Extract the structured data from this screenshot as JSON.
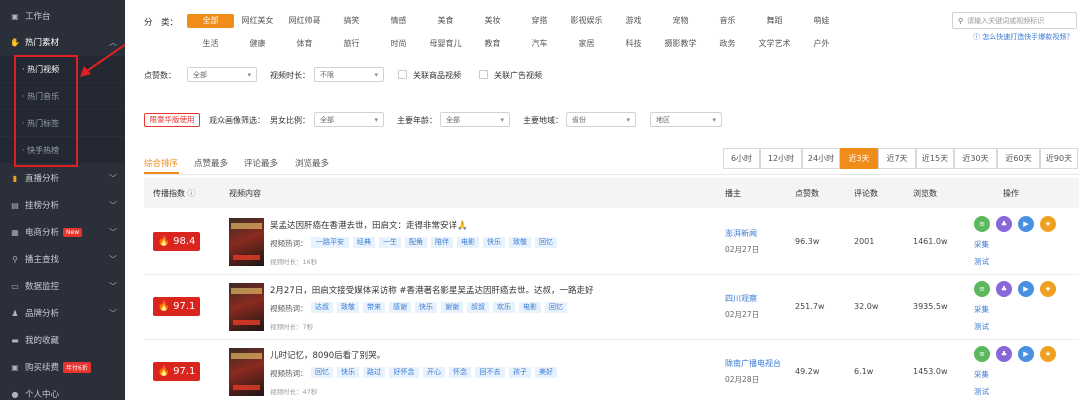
{
  "sidebar": {
    "top_item": "工作台",
    "section": "热门素材",
    "sub_items": [
      "热门视频",
      "热门音乐",
      "热门标签",
      "快手热榜"
    ],
    "items": [
      {
        "label": "直播分析"
      },
      {
        "label": "挂榜分析"
      },
      {
        "label": "电商分析",
        "badge": "New"
      },
      {
        "label": "播主查找"
      },
      {
        "label": "数据监控"
      },
      {
        "label": "品牌分析"
      },
      {
        "label": "我的收藏"
      },
      {
        "label": "购买续费",
        "badge": "年付6折"
      },
      {
        "label": "个人中心"
      }
    ]
  },
  "filters": {
    "category_label": "分　类：",
    "categories_row1": [
      "全部",
      "网红美女",
      "网红帅哥",
      "搞笑",
      "情感",
      "美食",
      "美妆",
      "穿搭",
      "影视娱乐",
      "游戏",
      "宠物",
      "音乐",
      "舞蹈",
      "萌娃"
    ],
    "categories_row2": [
      "生活",
      "健康",
      "体育",
      "旅行",
      "时尚",
      "母婴育儿",
      "教育",
      "汽车",
      "家居",
      "科技",
      "摄影教学",
      "政务",
      "文学艺术",
      "户外"
    ],
    "search_placeholder": "请输入关键词或视频标识",
    "help_link": "怎么快速打造快手爆款视频？",
    "likes_label": "点赞数：",
    "likes_value": "全部",
    "duration_label": "视频时长：",
    "duration_value": "不限",
    "related_product": "关联商品视频",
    "related_ad": "关联广告视频",
    "vip_tag": "限豪华版使用",
    "audience_label": "观众画像筛选：",
    "gender_label": "男女比例：",
    "gender_value": "全部",
    "age_label": "主要年龄：",
    "age_value": "全部",
    "region_label": "主要地域：",
    "province_value": "省份",
    "area_value": "地区"
  },
  "sort_tabs": [
    "综合排序",
    "点赞最多",
    "评论最多",
    "浏览最多"
  ],
  "time_tabs": [
    "6小时",
    "12小时",
    "24小时",
    "近3天",
    "近7天",
    "近15天",
    "近30天",
    "近60天",
    "近90天"
  ],
  "table": {
    "headers": [
      "传播指数",
      "视频内容",
      "播主",
      "点赞数",
      "评论数",
      "浏览数",
      "操作"
    ],
    "tags_label": "视频热词：",
    "op_labels": [
      "采集",
      "测试"
    ],
    "rows": [
      {
        "score": "98.4",
        "title": "吴孟达因肝癌在香港去世，田启文：走得非常安详🙏",
        "tags": [
          "一路平安",
          "经典",
          "一生",
          "配角",
          "陪伴",
          "电影",
          "快乐",
          "致敬",
          "回忆"
        ],
        "duration": "视频时长：16秒",
        "author": "澎湃新闻",
        "date": "02月27日",
        "likes": "96.3w",
        "comments": "2001",
        "views": "1461.0w"
      },
      {
        "score": "97.1",
        "title": "2月27日，田启文接受媒体采访称 #香港著名影星吴孟达因肝癌去世。达叔，一路走好",
        "tags": [
          "达叔",
          "致敬",
          "带来",
          "感谢",
          "快乐",
          "谢谢",
          "叔叔",
          "欢乐",
          "电影",
          "回忆"
        ],
        "duration": "视频时长：7秒",
        "author": "四川观察",
        "date": "02月27日",
        "likes": "251.7w",
        "comments": "32.0w",
        "views": "3935.5w"
      },
      {
        "score": "97.1",
        "title": "儿时记忆，8090后看了别哭。",
        "tags": [
          "回忆",
          "快乐",
          "路过",
          "好怀念",
          "开心",
          "怀念",
          "回不去",
          "孩子",
          "美好"
        ],
        "duration": "视频时长：47秒",
        "author": "陇南广播电视台",
        "date": "02月28日",
        "likes": "49.2w",
        "comments": "6.1w",
        "views": "1453.0w"
      }
    ]
  },
  "colors": {
    "accent": "#f08c1a",
    "score_red": "#d9251d",
    "link": "#3a7bd5",
    "sidebar_bg": "#2a2f3a"
  }
}
